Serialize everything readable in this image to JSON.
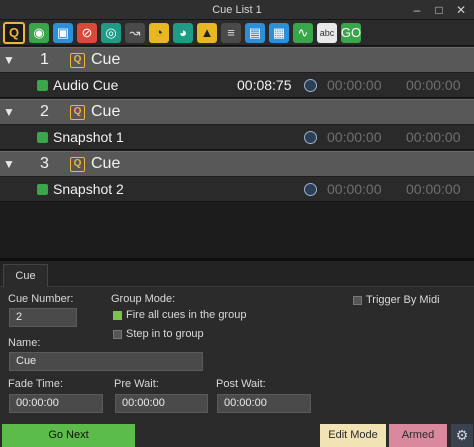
{
  "window": {
    "title": "Cue List 1"
  },
  "toolbar": [
    {
      "icon": "cue-q-icon",
      "glyph": "Q",
      "style": "q"
    },
    {
      "icon": "snapshot-icon",
      "glyph": "◉",
      "style": "green"
    },
    {
      "icon": "camera-icon",
      "glyph": "▣",
      "style": "blue"
    },
    {
      "icon": "no-entry-icon",
      "glyph": "⊘",
      "style": "red"
    },
    {
      "icon": "target-icon",
      "glyph": "◎",
      "style": "teal"
    },
    {
      "icon": "arrow-curve-icon",
      "glyph": "↝",
      "style": "gray"
    },
    {
      "icon": "dial-icon",
      "glyph": "◔",
      "style": "yellow"
    },
    {
      "icon": "pacman-icon",
      "glyph": "◕",
      "style": "teal"
    },
    {
      "icon": "metronome-icon",
      "glyph": "▲",
      "style": "yellow"
    },
    {
      "icon": "faders-icon",
      "glyph": "≡",
      "style": "gray"
    },
    {
      "icon": "windows-icon",
      "glyph": "▤",
      "style": "blue"
    },
    {
      "icon": "video-icon",
      "glyph": "▦",
      "style": "blue"
    },
    {
      "icon": "waveform-icon",
      "glyph": "∿",
      "style": "green"
    },
    {
      "icon": "text-abc-icon",
      "glyph": "abc",
      "style": "white"
    },
    {
      "icon": "go-icon",
      "glyph": "GO",
      "style": "green"
    }
  ],
  "cues": {
    "group1": {
      "number": "1",
      "name": "Cue"
    },
    "item1": {
      "name": "Audio Cue",
      "duration": "00:08:75",
      "prewait": "00:00:00",
      "postwait": "00:00:00"
    },
    "group2": {
      "number": "2",
      "name": "Cue"
    },
    "item2": {
      "name": "Snapshot 1",
      "prewait": "00:00:00",
      "postwait": "00:00:00"
    },
    "group3": {
      "number": "3",
      "name": "Cue"
    },
    "item3": {
      "name": "Snapshot 2",
      "prewait": "00:00:00",
      "postwait": "00:00:00"
    }
  },
  "panel": {
    "tab": "Cue",
    "cue_number_label": "Cue Number:",
    "cue_number_value": "2",
    "group_mode_label": "Group Mode:",
    "fire_all_label": "Fire all cues in the group",
    "step_in_label": "Step in to group",
    "trigger_midi_label": "Trigger By Midi",
    "name_label": "Name:",
    "name_value": "Cue",
    "fade_time_label": "Fade Time:",
    "fade_time_value": "00:00:00",
    "pre_wait_label": "Pre Wait:",
    "pre_wait_value": "00:00:00",
    "post_wait_label": "Post Wait:",
    "post_wait_value": "00:00:00"
  },
  "buttons": {
    "go": "Go Next",
    "edit": "Edit Mode",
    "armed": "Armed"
  },
  "colors": {
    "go": "#5cbc4a",
    "edit": "#f1e3b4",
    "armed": "#d9889d",
    "q_accent": "#f0b53c"
  }
}
